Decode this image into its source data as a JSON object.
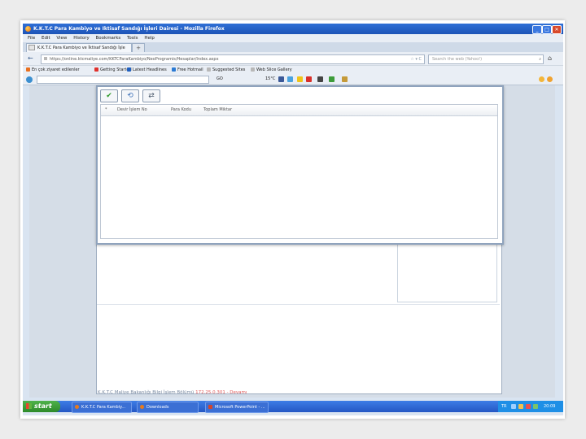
{
  "window": {
    "title": "K.K.T.C Para Kambiyo ve Iktisaf Sandığı İşleri Dairesi - Mozilla Firefox",
    "btn_min": "_",
    "btn_max": "□",
    "btn_close": "✕"
  },
  "menu": [
    "File",
    "Edit",
    "View",
    "History",
    "Bookmarks",
    "Tools",
    "Help"
  ],
  "tab": {
    "label": "K.K.T.C Para Kambiyo ve İktisaf Sandığı İşle",
    "new_tab": "+"
  },
  "nav": {
    "back": "←",
    "url": "https://online.ktcmaliye.com/KKTCParaKambiyo/NeoProgramis/Hesaplar/Index.aspx",
    "star": "☆ ▾ C",
    "search_placeholder": "Search the web (Yahoo!)",
    "search_icon": "⌕",
    "home": "⌂"
  },
  "bookmarks": [
    {
      "label": "En çok ziyaret edilenler",
      "color": "#e9701f"
    },
    {
      "label": "Getting Started",
      "color": "#e0312c"
    },
    {
      "label": "Latest Headlines",
      "color": "#1f5fbf"
    },
    {
      "label": "Free Hotmail",
      "color": "#2b7ad3"
    },
    {
      "label": "Suggested Sites",
      "color": "#b8b8b8"
    },
    {
      "label": "Web Slice Gallery",
      "color": "#b8b8b8"
    }
  ],
  "toolbar2": {
    "go": "GO",
    "temp": "15°C"
  },
  "dialog": {
    "btn_ok": "✔",
    "btn_refresh": "⟲",
    "btn_transfer": "⇄",
    "columns": [
      "*",
      "Devir İşlem No",
      "Para Kodu",
      "Toplam Miktar"
    ]
  },
  "status": {
    "text": "K.K.T.C Maliye Bakanlığı Bilgi İşlem Bölümü ",
    "ip": "172.25.0.301 - Devamı"
  },
  "taskbar": {
    "start": "start",
    "tasks": [
      {
        "label": "K.K.T.C Para Kambiy...",
        "color": "#e57a1e"
      },
      {
        "label": "Downloads",
        "color": "#e57a1e"
      },
      {
        "label": "Microsoft PowerPoint - ...",
        "color": "#d2452b"
      }
    ],
    "lang": "TR",
    "clock": "20:09"
  },
  "colors": {
    "titlebar": "#1d54b7",
    "taskbar": "#2457c4",
    "start": "#2d8a2a"
  }
}
